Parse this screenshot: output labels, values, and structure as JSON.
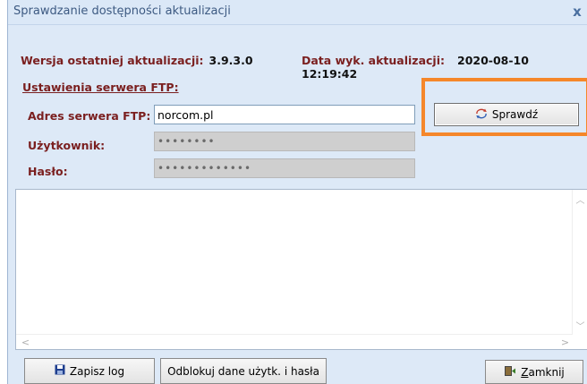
{
  "window": {
    "title": "Sprawdzanie dostępności aktualizacji",
    "close_glyph": "x"
  },
  "info": {
    "version_label": "Wersja ostatniej aktualizacji:",
    "version_value": "3.9.3.0",
    "date_label": "Data wyk. aktualizacji:",
    "date_value": "2020-08-10 12:19:42"
  },
  "ftp": {
    "section_title": "Ustawienia serwera FTP:",
    "server_label": "Adres serwera FTP:",
    "server_value": "norcom.pl",
    "user_label": "Użytkownik:",
    "user_value": "••••••••",
    "password_label": "Hasło:",
    "password_value": "•••••••••••••"
  },
  "buttons": {
    "check_label": "Sprawdź",
    "save_log_label": "Zapisz log",
    "unlock_label": "Odblokuj dane użytk. i hasła",
    "close_label_first": "Z",
    "close_label_rest": "amknij"
  },
  "icons": {
    "check": "refresh-icon",
    "save": "floppy-disk-icon",
    "close": "door-exit-icon"
  },
  "colors": {
    "label": "#7a1f1f",
    "title": "#3d5a82",
    "highlight": "#f5872a",
    "window_bg": "#dde9f7"
  }
}
